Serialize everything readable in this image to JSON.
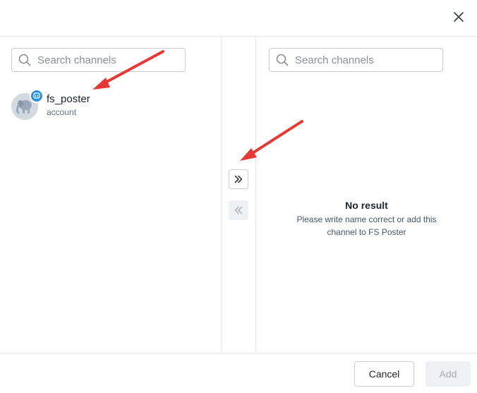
{
  "left": {
    "search": {
      "placeholder": "Search channels",
      "value": ""
    },
    "channels": [
      {
        "name": "fs_poster",
        "type": "account",
        "network_icon": "mastodon-icon"
      }
    ]
  },
  "right": {
    "search": {
      "placeholder": "Search channels",
      "value": ""
    },
    "empty": {
      "title": "No result",
      "description": "Please write name correct or add this channel to FS Poster"
    }
  },
  "transfer": {
    "move_right_icon": "chevrons-double-right-icon",
    "move_left_icon": "chevrons-double-left-icon",
    "move_left_enabled": false
  },
  "footer": {
    "cancel_label": "Cancel",
    "add_label": "Add",
    "add_enabled": false
  },
  "colors": {
    "accent_badge": "#2b90d9",
    "annotation_arrow": "#e53935",
    "border": "#c9ccd3",
    "disabled_bg": "#eef0f3"
  }
}
